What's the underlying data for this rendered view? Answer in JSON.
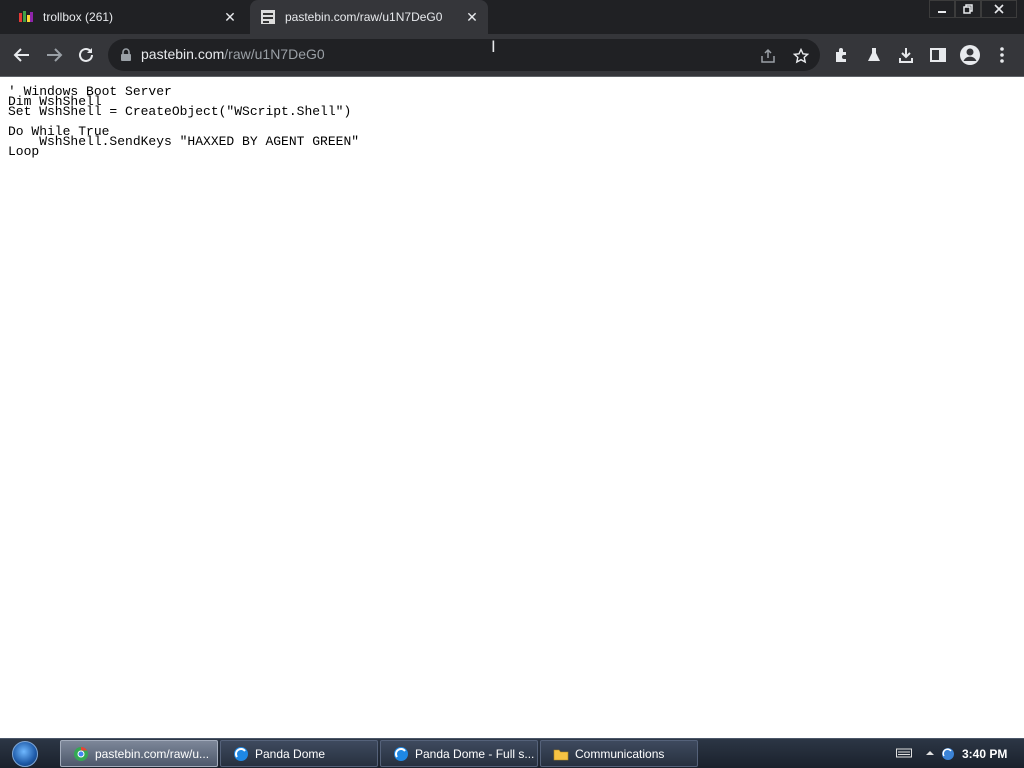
{
  "browser": {
    "tabs": [
      {
        "title": "trollbox (261)",
        "favicon": "trollbox-favicon",
        "active": false
      },
      {
        "title": "pastebin.com/raw/u1N7DeG0",
        "favicon": "pastebin-favicon",
        "active": true
      }
    ],
    "close_glyph": "✕",
    "address": {
      "host": "pastebin.com",
      "path": "/raw/u1N7DeG0"
    }
  },
  "page": {
    "lines": [
      "' Windows Boot Server",
      "Dim WshShell",
      "Set WshShell = CreateObject(\"WScript.Shell\")",
      "",
      "Do While True",
      "    WshShell.SendKeys \"HAXXED BY AGENT GREEN\"",
      "Loop"
    ]
  },
  "taskbar": {
    "items": [
      {
        "label": "pastebin.com/raw/u...",
        "icon": "chrome-icon",
        "active": true
      },
      {
        "label": "Panda Dome",
        "icon": "panda-icon",
        "active": false
      },
      {
        "label": "Panda Dome - Full s...",
        "icon": "panda-icon",
        "active": false
      },
      {
        "label": "Communications",
        "icon": "folder-icon",
        "active": false
      }
    ],
    "clock": "3:40 PM"
  },
  "colors": {
    "tab_strip": "#202124",
    "toolbar": "#35363a",
    "omnibox": "#202124"
  }
}
